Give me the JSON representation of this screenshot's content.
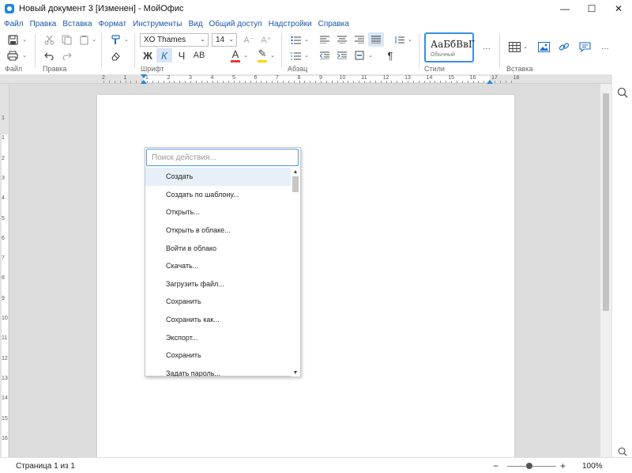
{
  "window": {
    "title": "Новый документ 3 [Изменен] - МойОфис",
    "minimize": "—",
    "maximize": "☐",
    "close": "✕"
  },
  "menu": [
    {
      "id": "file",
      "label": "Файл"
    },
    {
      "id": "edit",
      "label": "Правка"
    },
    {
      "id": "insert",
      "label": "Вставка"
    },
    {
      "id": "format",
      "label": "Формат"
    },
    {
      "id": "tools",
      "label": "Инструменты"
    },
    {
      "id": "view",
      "label": "Вид"
    },
    {
      "id": "share",
      "label": "Общий доступ"
    },
    {
      "id": "addons",
      "label": "Надстройки"
    },
    {
      "id": "help",
      "label": "Справка"
    }
  ],
  "toolbar": {
    "groups": {
      "file": "Файл",
      "edit": "Правка",
      "font": "Шрифт",
      "paragraph": "Абзац",
      "styles": "Стили",
      "insert": "Вставка"
    },
    "font_name": "XO Thames",
    "font_size": "14",
    "style_preview": "АаБбВвГ",
    "style_name": "Обычный",
    "icons": {
      "save": "save-icon",
      "print": "print-icon",
      "cut": "cut-icon",
      "copy": "copy-icon",
      "paste": "paste-icon",
      "undo": "undo-icon",
      "redo": "redo-icon",
      "paint": "format-painter-icon",
      "eraser": "eraser-icon",
      "table": "table-icon",
      "image": "image-icon",
      "link": "link-icon",
      "comment": "comment-icon",
      "more": "more-icon"
    },
    "glyphs": {
      "bold": "Ж",
      "italic": "К",
      "underline": "Ч",
      "caps": "АВ",
      "font_color": "A",
      "highlight": "✎",
      "grow": "A⁺",
      "shrink": "A⁻",
      "pilcrow": "¶",
      "more": "···",
      "dropdown": "⌄"
    }
  },
  "ruler": {
    "labels": [
      "2",
      "1",
      "1",
      "2",
      "3",
      "4",
      "5",
      "6",
      "7",
      "8",
      "9",
      "10",
      "11",
      "12",
      "13",
      "14",
      "15",
      "16",
      "17",
      "18"
    ],
    "vlabels": [
      "1",
      "1",
      "2",
      "3",
      "4",
      "5",
      "6",
      "7",
      "8",
      "9",
      "10",
      "11",
      "12",
      "13",
      "14",
      "15",
      "16"
    ]
  },
  "popup": {
    "search_placeholder": "Поиск действия...",
    "items": [
      "Создать",
      "Создать по шаблону...",
      "Открыть...",
      "Открыть в облаке...",
      "Войти в облако",
      "Скачать...",
      "Загрузить файл...",
      "Сохранить",
      "Сохранить как...",
      "Экспорт...",
      "Сохранить",
      "Задать пароль..."
    ],
    "highlighted_index": 0
  },
  "status": {
    "page": "Страница 1 из 1",
    "zoom": "100%",
    "zoom_minus": "−",
    "zoom_plus": "+"
  },
  "colors": {
    "accent": "#3b8fe0",
    "menu_text": "#1a57a8",
    "font_color_bar": "#e53935",
    "highlight_bar": "#ffd400"
  }
}
